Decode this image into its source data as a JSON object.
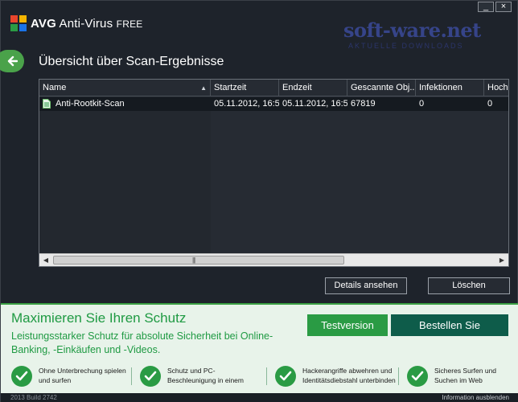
{
  "app": {
    "brand": "AVG",
    "name": "Anti-Virus",
    "edition": "FREE"
  },
  "watermark": {
    "text": "soft-ware.net",
    "sub": "AKTUELLE DOWNLOADS"
  },
  "window_controls": {
    "minimize": "_",
    "close": "×"
  },
  "page": {
    "title": "Übersicht über Scan-Ergebnisse"
  },
  "table": {
    "columns": [
      "Name",
      "Startzeit",
      "Endzeit",
      "Gescannte Obj...",
      "Infektionen",
      "Hoch"
    ],
    "rows": [
      {
        "name": "Anti-Rootkit-Scan",
        "start": "05.11.2012, 16:5",
        "end": "05.11.2012, 16:5",
        "scanned": "67819",
        "infections": "0",
        "high": "0"
      }
    ]
  },
  "actions": {
    "details": "Details ansehen",
    "delete": "Löschen"
  },
  "promo": {
    "title": "Maximieren Sie Ihren Schutz",
    "text": "Leistungsstarker Schutz für absolute Sicherheit bei Online-Banking, -Einkäufen und -Videos.",
    "trial_button": "Testversion",
    "buy_button": "Bestellen Sie",
    "features": [
      "Ohne Unterbrechung spielen und surfen",
      "Schutz und PC-Beschleunigung in einem",
      "Hackerangriffe abwehren und Identitätsdiebstahl unterbinden",
      "Sicheres Surfen und Suchen im Web"
    ]
  },
  "status": {
    "build": "2013 Build 2742",
    "hide_info": "Information ausblenden"
  },
  "colors": {
    "background": "#1e232b",
    "accent_green": "#2a9b44",
    "buy_dark_green": "#0e5c4a",
    "promo_bg": "#e8f3ea"
  },
  "icons": [
    "avg-logo-icon",
    "back-arrow-icon",
    "document-icon",
    "checkmark-icon",
    "sort-up-icon"
  ]
}
